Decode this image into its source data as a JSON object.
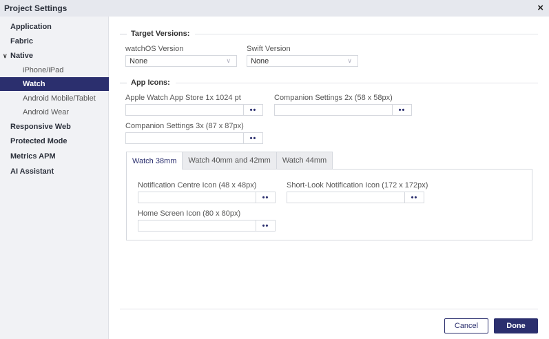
{
  "window": {
    "title": "Project Settings",
    "close_glyph": "×"
  },
  "sidebar": {
    "items": [
      {
        "label": "Application",
        "level": "top"
      },
      {
        "label": "Fabric",
        "level": "top"
      },
      {
        "label": "Native",
        "level": "top",
        "expanded": true
      },
      {
        "label": "iPhone/iPad",
        "level": "sub"
      },
      {
        "label": "Watch",
        "level": "sub",
        "active": true
      },
      {
        "label": "Android Mobile/Tablet",
        "level": "sub"
      },
      {
        "label": "Android Wear",
        "level": "sub"
      },
      {
        "label": "Responsive Web",
        "level": "top"
      },
      {
        "label": "Protected Mode",
        "level": "top"
      },
      {
        "label": "Metrics APM",
        "level": "top"
      },
      {
        "label": "AI Assistant",
        "level": "top"
      }
    ]
  },
  "target_versions": {
    "heading": "Target Versions:",
    "watchos": {
      "label": "watchOS Version",
      "value": "None"
    },
    "swift": {
      "label": "Swift Version",
      "value": "None"
    }
  },
  "app_icons": {
    "heading": "App Icons:",
    "store": {
      "label": "Apple Watch App Store 1x 1024 pt"
    },
    "companion2x": {
      "label": "Companion Settings 2x (58 x 58px)"
    },
    "companion3x": {
      "label": "Companion Settings 3x (87 x 87px)"
    },
    "browse_glyph": "••"
  },
  "tabs": [
    {
      "label": "Watch 38mm",
      "active": true
    },
    {
      "label": "Watch 40mm and 42mm",
      "active": false
    },
    {
      "label": "Watch 44mm",
      "active": false
    }
  ],
  "tab_panel": {
    "notification": {
      "label": "Notification Centre Icon (48 x 48px)"
    },
    "short_look": {
      "label": "Short-Look Notification Icon (172 x 172px)"
    },
    "home_screen": {
      "label": "Home Screen Icon (80 x 80px)"
    }
  },
  "footer": {
    "cancel_label": "Cancel",
    "done_label": "Done"
  },
  "colors": {
    "accent": "#2b2f6e",
    "sidebar_bg": "#f1f2f5",
    "titlebar_bg": "#e6e8ee"
  }
}
